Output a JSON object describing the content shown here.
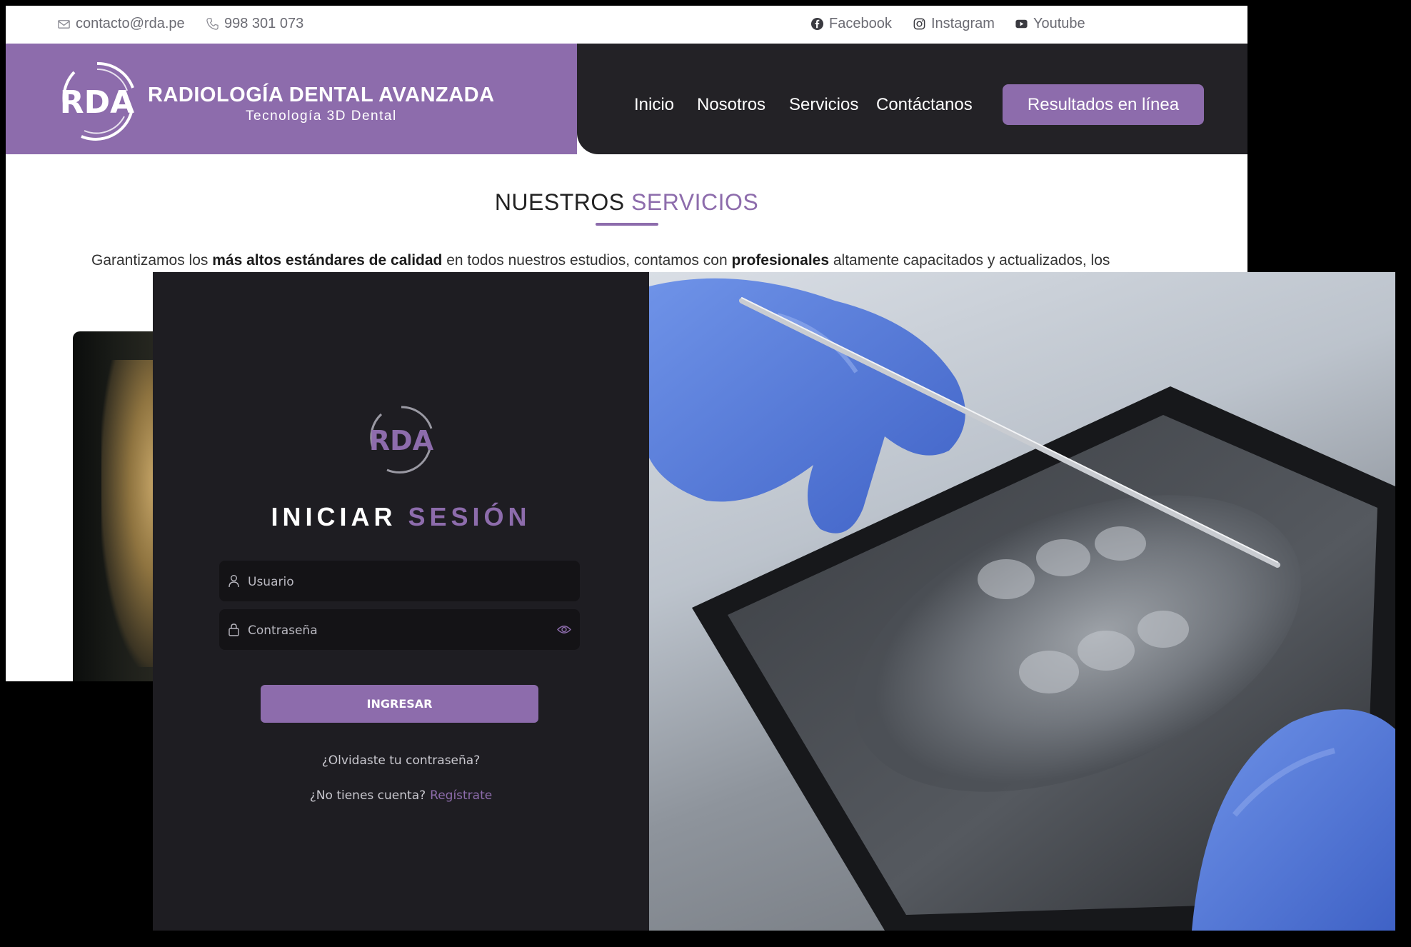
{
  "site": {
    "topbar": {
      "email": "contacto@rda.pe",
      "phone": "998 301 073",
      "social": [
        "Facebook",
        "Instagram",
        "Youtube"
      ]
    },
    "brand": {
      "logo_text": "RDA",
      "name": "RADIOLOGÍA DENTAL AVANZADA",
      "tagline": "Tecnología 3D Dental"
    },
    "nav": [
      "Inicio",
      "Nosotros",
      "Servicios",
      "Contáctanos"
    ],
    "cta": "Resultados en línea",
    "services": {
      "title_main": "NUESTROS ",
      "title_accent": "SERVICIOS",
      "intro_parts": [
        "Garantizamos los ",
        "más altos estándares de calidad",
        " en todos nuestros estudios, contamos con ",
        "profesionales",
        " altamente capacitados y actualizados, los"
      ]
    }
  },
  "login": {
    "logo_text": "RDA",
    "title_main": "INICIAR ",
    "title_accent": "SESIÓN",
    "username_placeholder": "Usuario",
    "password_placeholder": "Contraseña",
    "submit": "INGRESAR",
    "forgot": "¿Olvidaste tu contraseña?",
    "no_account": "¿No tienes cuenta?",
    "register": "Regístrate"
  },
  "colors": {
    "brand_purple": "#8d6cac",
    "dark_header": "#232226",
    "login_bg": "#1e1d22"
  },
  "icons": {
    "topbar": [
      "mail-icon",
      "phone-icon",
      "facebook-icon",
      "instagram-icon",
      "youtube-icon"
    ],
    "login": [
      "user-icon",
      "lock-icon",
      "eye-icon"
    ]
  }
}
